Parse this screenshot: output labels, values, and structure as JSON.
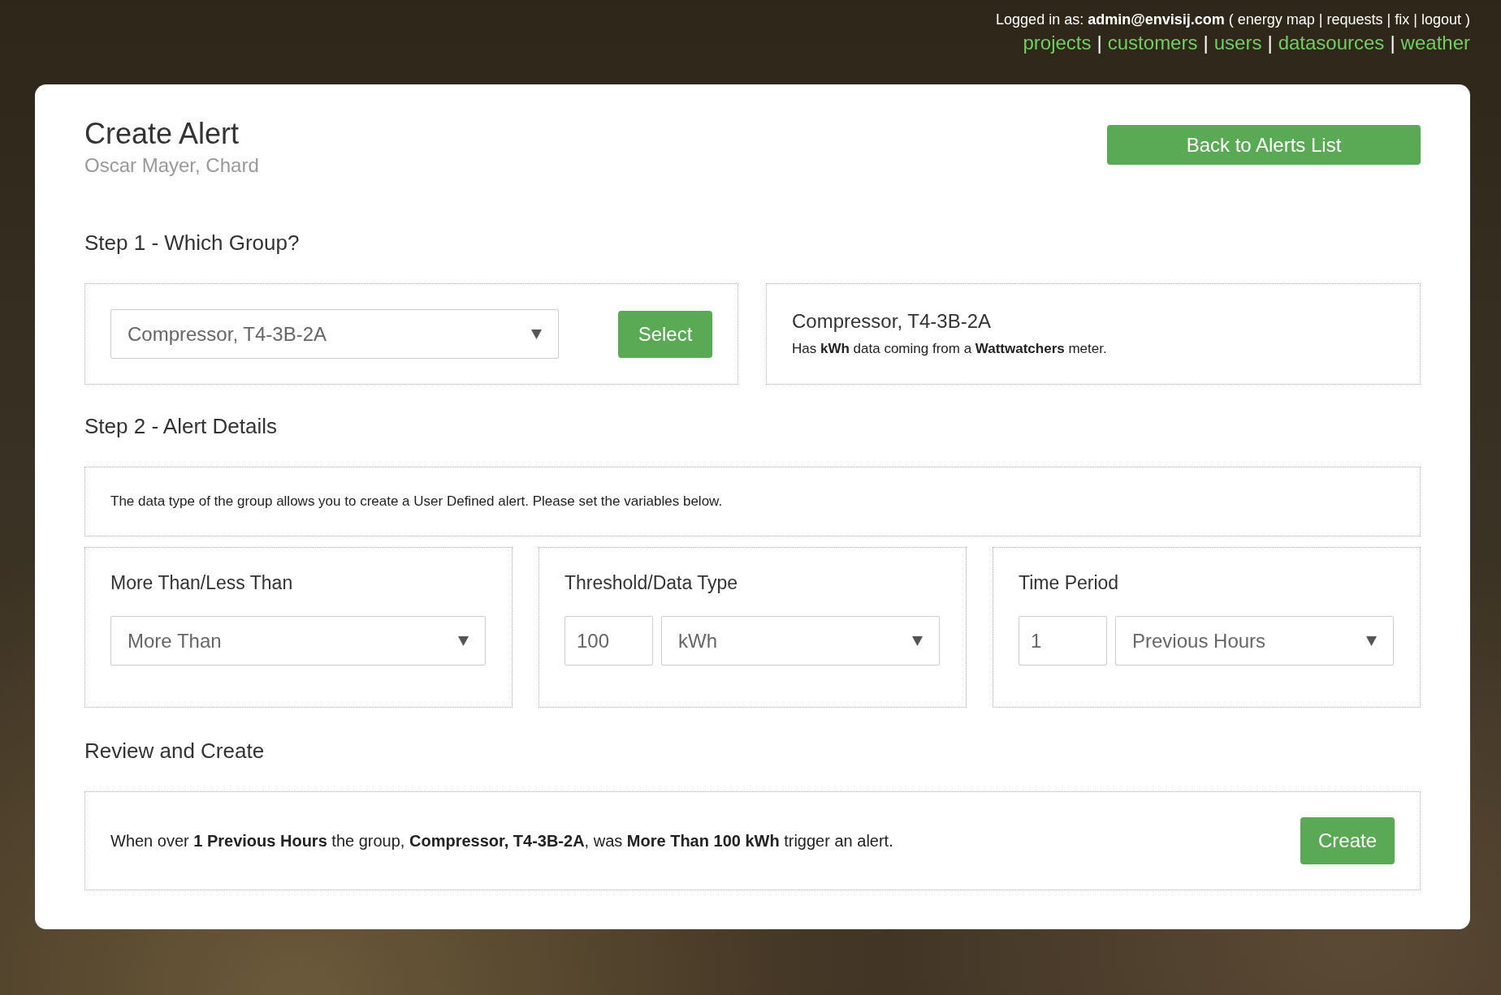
{
  "header": {
    "logged_in_label": "Logged in as:",
    "user": "admin@envisij.com",
    "open": "(",
    "close": ")",
    "separator": "|",
    "admin_links": [
      "energy map",
      "requests",
      "fix",
      "logout"
    ],
    "nav_links": [
      "projects",
      "customers",
      "users",
      "datasources",
      "weather"
    ]
  },
  "page": {
    "title": "Create Alert",
    "subtitle": "Oscar Mayer, Chard",
    "back_button": "Back to Alerts List"
  },
  "step1": {
    "heading": "Step 1 - Which Group?",
    "group_select": {
      "value": "Compressor, T4-3B-2A"
    },
    "select_button": "Select",
    "group_info": {
      "name": "Compressor, T4-3B-2A",
      "description": "Has **kWh** data coming from a **Wattwatchers** meter."
    }
  },
  "step2": {
    "heading": "Step 2 - Alert Details",
    "info": "The data type of the group allows you to create a User Defined alert. Please set the variables below.",
    "panels": [
      {
        "label": "More Than/Less Than",
        "kind": "select",
        "select": "More Than"
      },
      {
        "label": "Threshold/Data Type",
        "kind": "number-select",
        "number": "100",
        "select": "kWh"
      },
      {
        "label": "Time Period",
        "kind": "number-select",
        "number": "1",
        "select": "Previous Hours"
      }
    ]
  },
  "review": {
    "heading": "Review and Create",
    "summary": "When over **1 Previous Hours** the group, **Compressor, T4-3B-2A**, was **More Than 100 kWh** trigger an alert.",
    "create_button": "Create"
  }
}
